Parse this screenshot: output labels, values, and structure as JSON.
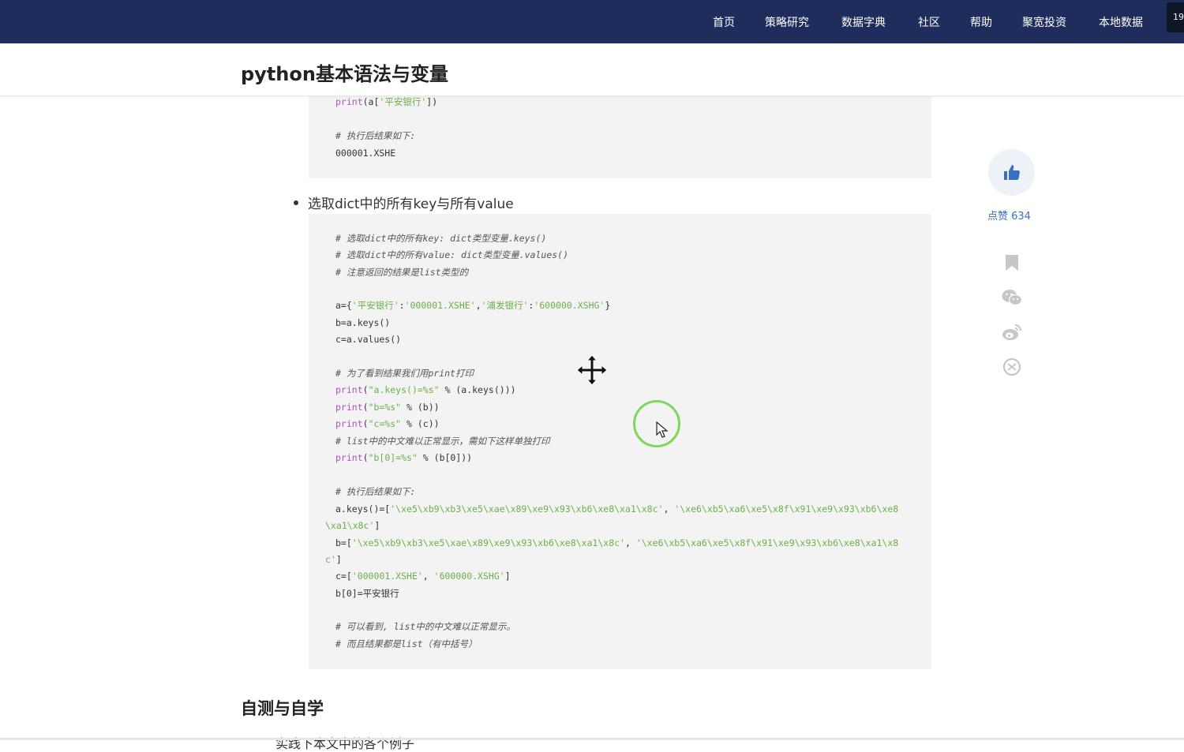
{
  "nav": {
    "items": [
      "首页",
      "策略研究",
      "数据字典",
      "社区",
      "帮助",
      "聚宽投资",
      "本地数据"
    ],
    "corner_text": "19"
  },
  "article": {
    "title": "python基本语法与变量",
    "bullet": "选取dict中的所有key与所有value",
    "section_heading": "自测与自学",
    "cut_text": "实践下本文中的各个例子"
  },
  "code1": [
    {
      "kw": "print",
      "rest_pre": "(a[",
      "str": "'平安银行'",
      "rest_post": "])"
    },
    {
      "cmt": "# 执行后结果如下:"
    },
    {
      "text": "000001.XSHE"
    }
  ],
  "code2": {
    "c1": "# 选取dict中的所有key: dict类型变量.keys()",
    "c2": "# 选取dict中的所有value: dict类型变量.values()",
    "c3": "# 注意返回的结果是list类型的",
    "l_a_pre": "a={",
    "l_a_s1": "'平安银行'",
    "l_a_colon1": ":",
    "l_a_s2": "'000001.XSHE'",
    "l_a_comma": ",",
    "l_a_s3": "'浦发银行'",
    "l_a_colon2": ":",
    "l_a_s4": "'600000.XSHG'",
    "l_a_post": "}",
    "l_b": "b=a.keys()",
    "l_c": "c=a.values()",
    "c4": "# 为了看到结果我们用print打印",
    "p1_kw": "print",
    "p1_open": "(",
    "p1_str": "\"a.keys()=%s\"",
    "p1_rest": " % (a.keys()))",
    "p2_kw": "print",
    "p2_open": "(",
    "p2_str": "\"b=%s\"",
    "p2_rest": " % (b))",
    "p3_kw": "print",
    "p3_open": "(",
    "p3_str": "\"c=%s\"",
    "p3_rest": " % (c))",
    "c5": "# list中的中文难以正常显示，需如下这样单独打印",
    "p4_kw": "print",
    "p4_open": "(",
    "p4_str": "\"b[0]=%s\"",
    "p4_rest": " % (b[0]))",
    "c6": "# 执行后结果如下:",
    "r1_pre": "a.keys()=[",
    "r1_s1": "'\\xe5\\xb9\\xb3\\xe5\\xae\\x89\\xe9\\x93\\xb6\\xe8\\xa1\\x8c'",
    "r1_mid": ", ",
    "r1_s2a": "'\\xe6\\xb5\\xa6\\xe5\\x8f\\x91\\xe9\\x93\\xb6\\xe8",
    "r1_s2b": "\\xa1\\x8c'",
    "r1_end": "]",
    "r2_pre": "b=[",
    "r2_s1": "'\\xe5\\xb9\\xb3\\xe5\\xae\\x89\\xe9\\x93\\xb6\\xe8\\xa1\\x8c'",
    "r2_mid": ", ",
    "r2_s2a": "'\\xe6\\xb5\\xa6\\xe5\\x8f\\x91\\xe9\\x93\\xb6\\xe8\\xa1\\x8",
    "r2_s2b": "c'",
    "r2_end": "]",
    "r3_pre": "c=[",
    "r3_s1": "'000001.XSHE'",
    "r3_mid": ", ",
    "r3_s2": "'600000.XSHG'",
    "r3_end": "]",
    "r4": "b[0]=平安银行",
    "c7": "# 可以看到, list中的中文难以正常显示。",
    "c8": "# 而且结果都是list（有中括号）"
  },
  "sidebar": {
    "like_count": "点赞 634",
    "icons": [
      "thumbs-up-icon",
      "bookmark-icon",
      "wechat-icon",
      "weibo-icon",
      "share-icon"
    ]
  },
  "colors": {
    "nav_bg": "#1e2d5c",
    "accent": "#3a6fc2",
    "code_bg": "#f3f3f3",
    "keyword": "#b252c2",
    "string": "#6bb04a",
    "click_ring": "#7fd65a"
  }
}
